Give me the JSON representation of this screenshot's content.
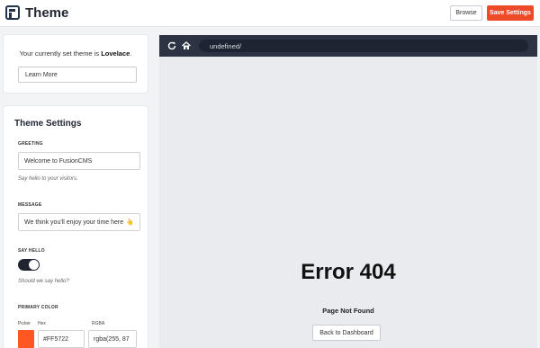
{
  "header": {
    "title": "Theme",
    "browse_label": "Browse",
    "save_label": "Save Settings"
  },
  "current_theme": {
    "prefix": "Your currently set theme is ",
    "name": "Lovelace",
    "suffix": ".",
    "learn_more_label": "Learn More"
  },
  "settings": {
    "title": "Theme Settings",
    "greeting": {
      "label": "GREETING",
      "value": "Welcome to FusionCMS",
      "help": "Say hello to your visitors."
    },
    "message": {
      "label": "MESSAGE",
      "value": "We think you'll enjoy your time here",
      "emoji": "👆",
      "help": ""
    },
    "say_hello": {
      "label": "SAY HELLO",
      "enabled": true,
      "help": "Should we say hello?"
    },
    "primary_color": {
      "label": "PRIMARY COLOR",
      "picker_label": "Picker",
      "hex_label": "Hex",
      "rgba_label": "RGBA",
      "hex_value": "#FF5722",
      "rgba_value": "rgba(255, 87",
      "swatch_color": "#FF5722"
    }
  },
  "preview": {
    "url": "undefined/",
    "error_title": "Error 404",
    "error_subtitle": "Page Not Found",
    "back_label": "Back to Dashboard"
  },
  "colors": {
    "accent": "#ee4a2a",
    "browser_bar": "#2d3342"
  },
  "icons": {
    "reload": "reload-icon",
    "home": "home-icon",
    "logo": "fusioncms-logo-icon"
  }
}
